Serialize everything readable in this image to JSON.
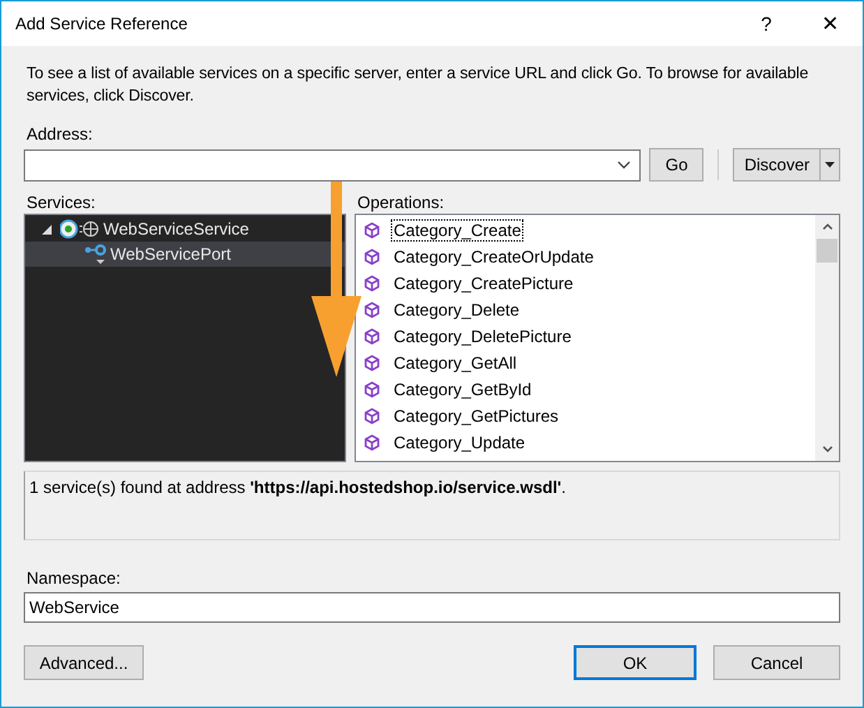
{
  "window": {
    "title": "Add Service Reference",
    "help": "?",
    "close": "✕"
  },
  "description": "To see a list of available services on a specific server, enter a service URL and click Go. To browse for available services, click Discover.",
  "address": {
    "label": "Address:"
  },
  "go_button": "Go",
  "discover_button": "Discover",
  "services": {
    "label": "Services:",
    "tree": [
      {
        "label": "WebServiceService",
        "expanded": true,
        "selected": false,
        "children": [
          {
            "label": "WebServicePort",
            "selected": true
          }
        ]
      }
    ]
  },
  "operations": {
    "label": "Operations:",
    "items": [
      {
        "label": "Category_Create",
        "focused": true
      },
      {
        "label": "Category_CreateOrUpdate",
        "focused": false
      },
      {
        "label": "Category_CreatePicture",
        "focused": false
      },
      {
        "label": "Category_Delete",
        "focused": false
      },
      {
        "label": "Category_DeletePicture",
        "focused": false
      },
      {
        "label": "Category_GetAll",
        "focused": false
      },
      {
        "label": "Category_GetById",
        "focused": false
      },
      {
        "label": "Category_GetPictures",
        "focused": false
      },
      {
        "label": "Category_Update",
        "focused": false
      }
    ]
  },
  "status": "1 service(s) found at address **'https://api.hostedshop.io/service.wsdl'**.",
  "namespace": {
    "label": "Namespace:",
    "value": "WebService"
  },
  "buttons": {
    "advanced": "Advanced...",
    "ok": "OK",
    "cancel": "Cancel"
  }
}
